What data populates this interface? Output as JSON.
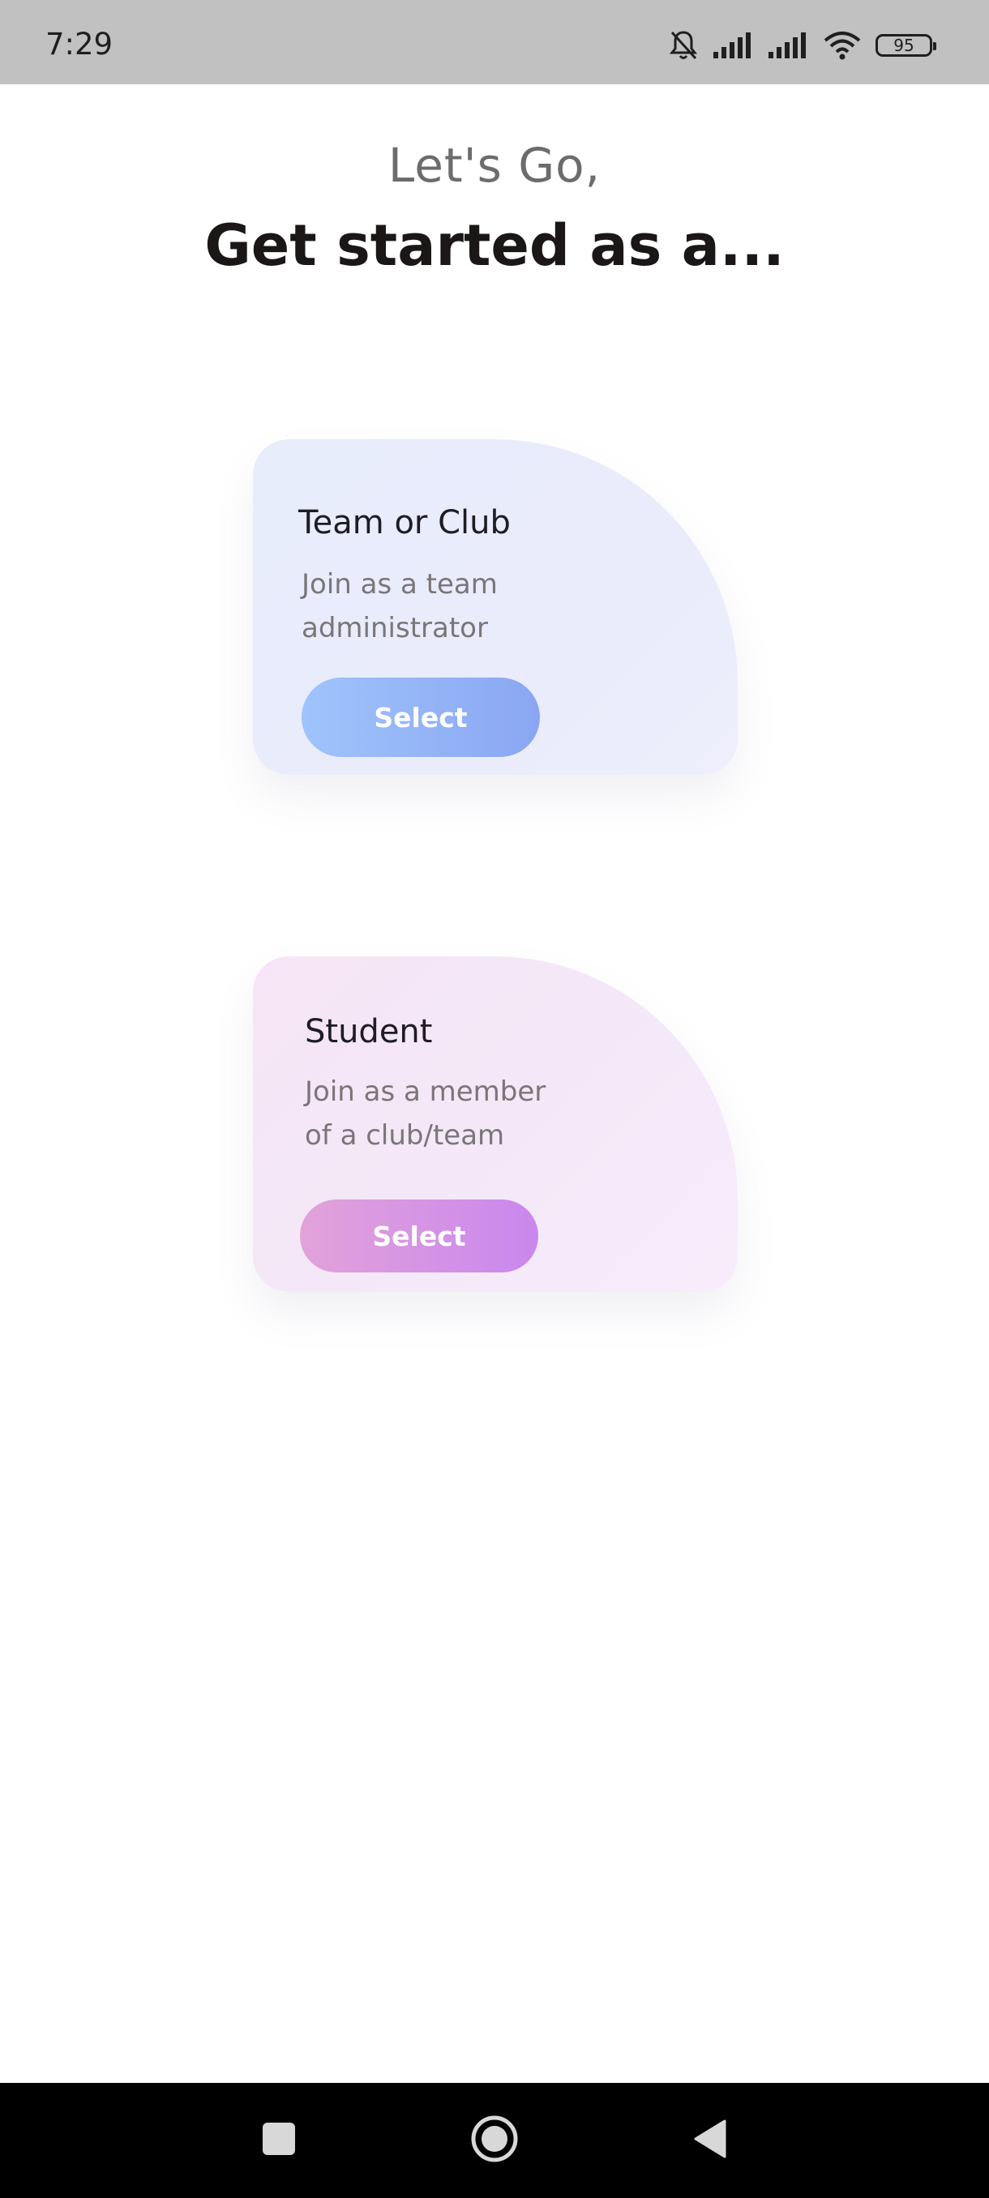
{
  "status_bar": {
    "time": "7:29",
    "battery_level": "95",
    "icons": [
      "bell-muted-icon",
      "signal-icon",
      "signal-icon",
      "wifi-icon",
      "battery-icon"
    ]
  },
  "header": {
    "greeting": "Let's Go,",
    "headline": "Get started as a..."
  },
  "cards": [
    {
      "title": "Team or Club",
      "description_line1": "Join as a team",
      "description_line2": "administrator",
      "button_label": "Select"
    },
    {
      "title": "Student",
      "description_line1": "Join as a member",
      "description_line2": "of a club/team",
      "button_label": "Select"
    }
  ],
  "nav_bar": {
    "buttons": [
      "recent-apps-icon",
      "home-icon",
      "back-icon"
    ]
  },
  "colors": {
    "status_bar_bg": "#c1c1c1",
    "team_button": "#8aa6f2",
    "student_button": "#c987ee",
    "headline_text": "#1b1717"
  }
}
